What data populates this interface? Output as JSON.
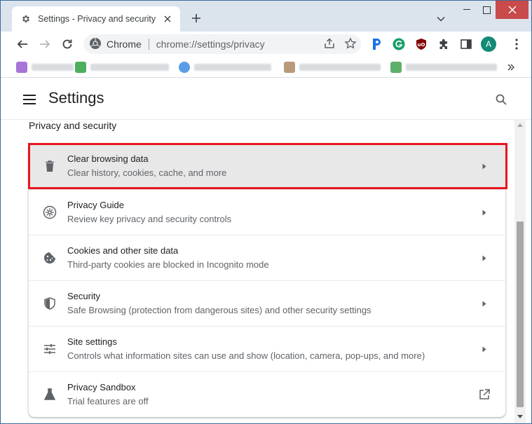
{
  "tab": {
    "title": "Settings - Privacy and security"
  },
  "toolbar": {
    "site_chip": "Chrome",
    "url": "chrome://settings/privacy",
    "avatar_letter": "A"
  },
  "settings": {
    "title": "Settings",
    "section_title": "Privacy and security",
    "items": [
      {
        "label": "Clear browsing data",
        "subtitle": "Clear history, cookies, cache, and more",
        "icon": "trash-icon",
        "highlighted": true
      },
      {
        "label": "Privacy Guide",
        "subtitle": "Review key privacy and security controls",
        "icon": "compass-icon"
      },
      {
        "label": "Cookies and other site data",
        "subtitle": "Third-party cookies are blocked in Incognito mode",
        "icon": "cookie-icon"
      },
      {
        "label": "Security",
        "subtitle": "Safe Browsing (protection from dangerous sites) and other security settings",
        "icon": "shield-icon"
      },
      {
        "label": "Site settings",
        "subtitle": "Controls what information sites can use and show (location, camera, pop-ups, and more)",
        "icon": "tune-icon"
      },
      {
        "label": "Privacy Sandbox",
        "subtitle": "Trial features are off",
        "icon": "flask-icon",
        "external": true
      }
    ]
  },
  "colors": {
    "tabstrip": "#dbe3ed",
    "highlight_border": "#e8141d",
    "highlight_bg": "#e8e8e8",
    "avatar": "#128a76",
    "window_close": "#c84a4a"
  }
}
